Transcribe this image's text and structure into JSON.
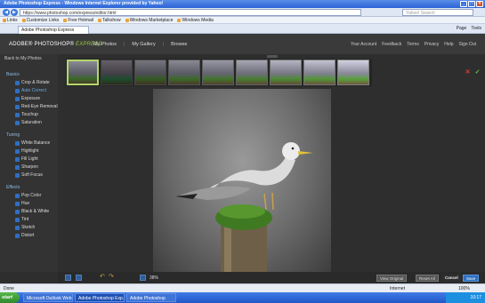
{
  "window": {
    "title": "Adobe Photoshop Express - Windows Internet Explorer provided by Yahoo!"
  },
  "browser": {
    "url": "https://www.photoshop.com/express/editor.html",
    "search_placeholder": "Yahoo! Search",
    "favorites": [
      "Links",
      "Customize Links",
      "Free Hotmail",
      "Talkshow",
      "Windows Marketplace",
      "Windows Media"
    ],
    "tab_title": "Adobe Photoshop Express",
    "commands": [
      "Page",
      "Tools"
    ],
    "status_left": "Done",
    "status_right": "Internet",
    "zoom": "100%"
  },
  "app": {
    "logo_main": "ADOBE® PHOTOSHOP®",
    "logo_accent": "EXPRESS",
    "nav": [
      "My Photos",
      "My Gallery",
      "Browse"
    ],
    "user_nav": [
      "Your Account",
      "Feedback",
      "Terms",
      "Privacy",
      "Help",
      "Sign Out"
    ],
    "back_link": "Back to My Photos",
    "categories": [
      {
        "name": "Basics",
        "tools": [
          "Crop & Rotate",
          "Auto Correct",
          "Exposure",
          "Red-Eye Removal",
          "Touchup",
          "Saturation"
        ]
      },
      {
        "name": "Tuning",
        "tools": [
          "White Balance",
          "Highlight",
          "Fill Light",
          "Sharpen",
          "Soft Focus"
        ]
      },
      {
        "name": "Effects",
        "tools": [
          "Pop Color",
          "Hue",
          "Black & White",
          "Tint",
          "Sketch",
          "Distort"
        ]
      }
    ],
    "selected_tool": "Auto Correct",
    "zoom_level": "38%",
    "buttons": {
      "view_original": "View Original",
      "reset_all": "Reset All",
      "cancel": "Cancel",
      "save": "Save"
    }
  },
  "taskbar": {
    "start": "start",
    "items": [
      "Microsoft Outlook Web A...",
      "Adobe Photoshop Exp...",
      "Adobe Photoshop"
    ],
    "clock": "10:17"
  },
  "colors": {
    "accent_blue": "#2d6fc2",
    "express_green": "#9ccc3c",
    "tool_label": "#6aaae8"
  }
}
